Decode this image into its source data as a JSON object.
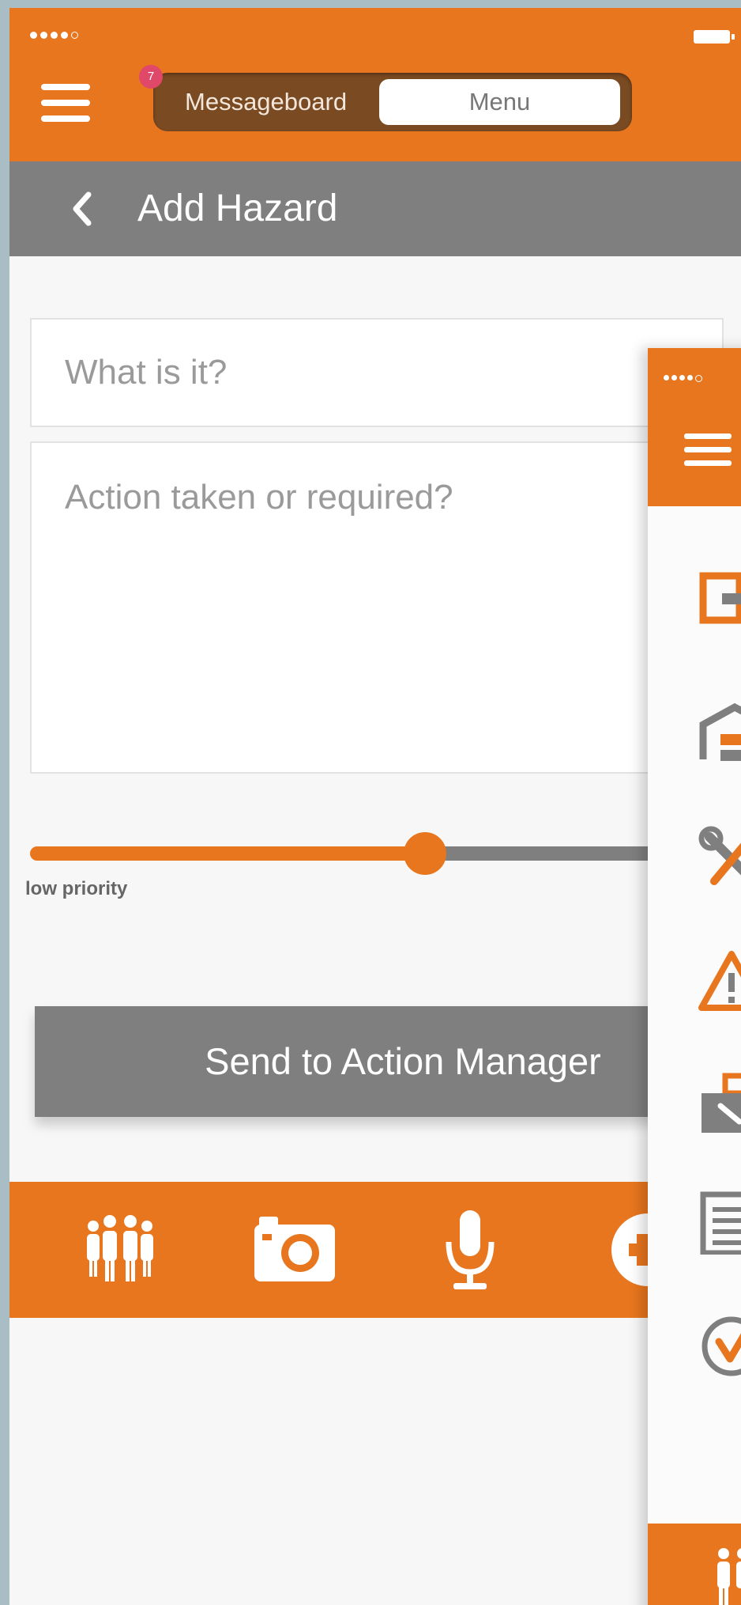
{
  "header": {
    "badge_count": "7",
    "segment_left": "Messageboard",
    "segment_right": "Menu"
  },
  "page": {
    "title": "Add Hazard"
  },
  "form": {
    "what_placeholder": "What is it?",
    "action_placeholder": "Action taken or required?",
    "priority_label": "low priority",
    "priority_level": 0.57,
    "send_label": "Send to Action Manager"
  },
  "toolbar": {
    "icons": [
      "team-icon",
      "camera-icon",
      "microphone-icon",
      "add-icon"
    ]
  },
  "second_screen": {
    "menu_icons": [
      "exit-icon",
      "building-icon",
      "tools-icon",
      "warning-icon",
      "toolbox-icon",
      "document-icon",
      "check-icon"
    ]
  },
  "colors": {
    "accent": "#e8761e",
    "bar_gray": "#7f7f80",
    "badge": "#e0486a",
    "backdrop": "#a8bdc4"
  }
}
